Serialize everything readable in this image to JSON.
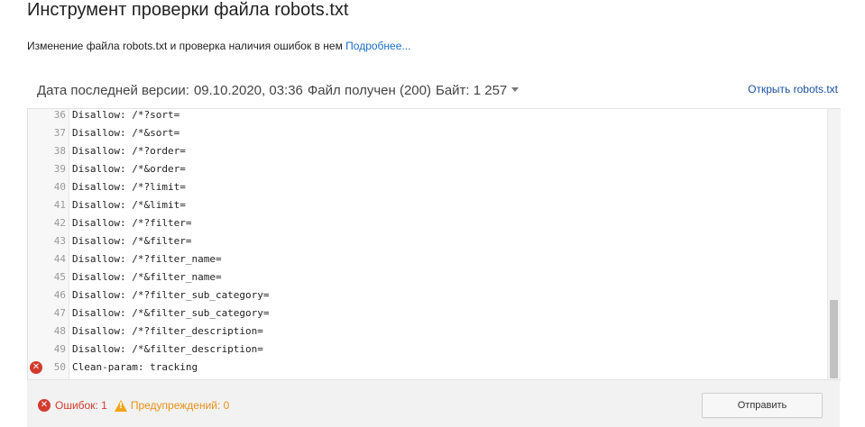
{
  "header": {
    "title": "Инструмент проверки файла robots.txt",
    "subtitle": "Изменение файла robots.txt и проверка наличия ошибок в нем",
    "more_link": "Подробнее..."
  },
  "version": {
    "label": "Дата последней версии:",
    "date": "09.10.2020, 03:36",
    "status": "Файл получен (200)",
    "bytes": "Байт: 1 257",
    "open_link": "Открыть robots.txt"
  },
  "editor": {
    "lines": [
      {
        "num": "36",
        "text": "Disallow: /*?sort=",
        "error": false
      },
      {
        "num": "37",
        "text": "Disallow: /*&sort=",
        "error": false
      },
      {
        "num": "38",
        "text": "Disallow: /*?order=",
        "error": false
      },
      {
        "num": "39",
        "text": "Disallow: /*&order=",
        "error": false
      },
      {
        "num": "40",
        "text": "Disallow: /*?limit=",
        "error": false
      },
      {
        "num": "41",
        "text": "Disallow: /*&limit=",
        "error": false
      },
      {
        "num": "42",
        "text": "Disallow: /*?filter=",
        "error": false
      },
      {
        "num": "43",
        "text": "Disallow: /*&filter=",
        "error": false
      },
      {
        "num": "44",
        "text": "Disallow: /*?filter_name=",
        "error": false
      },
      {
        "num": "45",
        "text": "Disallow: /*&filter_name=",
        "error": false
      },
      {
        "num": "46",
        "text": "Disallow: /*?filter_sub_category=",
        "error": false
      },
      {
        "num": "47",
        "text": "Disallow: /*&filter_sub_category=",
        "error": false
      },
      {
        "num": "48",
        "text": "Disallow: /*?filter_description=",
        "error": false
      },
      {
        "num": "49",
        "text": "Disallow: /*&filter_description=",
        "error": false
      },
      {
        "num": "50",
        "text": "Clean-param: tracking",
        "error": true
      }
    ]
  },
  "footer": {
    "errors": "Ошибок: 1",
    "warnings": "Предупреждений: 0",
    "submit": "Отправить"
  },
  "colors": {
    "error": "#d23b2e",
    "warning": "#f2a51a",
    "link": "#1a6fc8"
  },
  "icons": {
    "error": "error-circle-icon",
    "warning": "warning-triangle-icon",
    "dropdown": "caret-down-icon"
  }
}
